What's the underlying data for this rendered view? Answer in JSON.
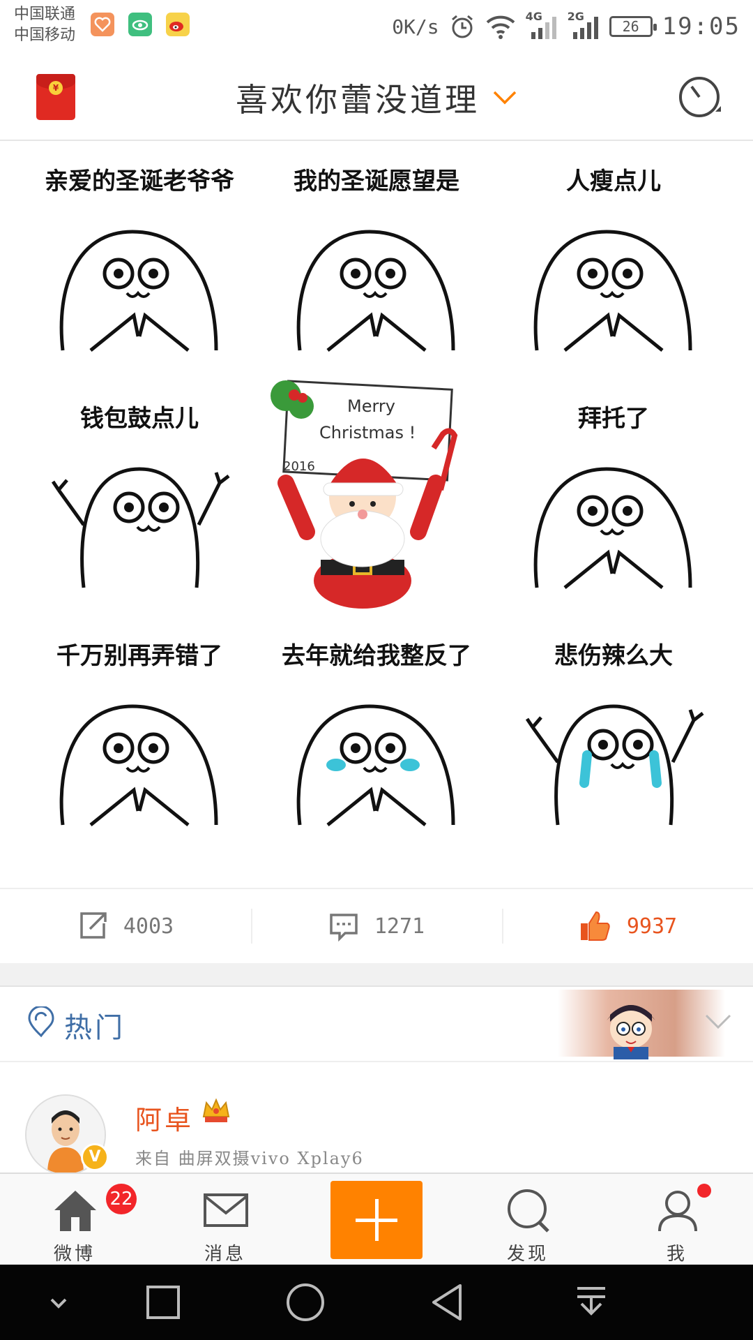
{
  "status_bar": {
    "carrier_1": "中国联通",
    "carrier_2": "中国移动",
    "net_speed": "0K/s",
    "net_1": "4G",
    "net_2": "2G",
    "battery": "26",
    "time": "19:05",
    "notification_icons": [
      "health-app-icon",
      "eye-app-icon",
      "weibo-app-icon"
    ]
  },
  "header": {
    "title": "喜欢你蕾没道理",
    "left_icon": "red-packet-icon",
    "right_icon": "timer-icon",
    "accent": "#ff8200"
  },
  "image_grid": {
    "cells": [
      {
        "caption": "亲爱的圣诞老爷爷",
        "pose": "praying"
      },
      {
        "caption": "我的圣诞愿望是",
        "pose": "praying"
      },
      {
        "caption": "人瘦点儿",
        "pose": "praying"
      },
      {
        "caption": "钱包鼓点儿",
        "pose": "arms-up"
      },
      {
        "caption": "",
        "pose": "santa",
        "sign_line_1": "Merry",
        "sign_line_2": "Christmas !",
        "sign_year": "2016"
      },
      {
        "caption": "拜托了",
        "pose": "praying"
      },
      {
        "caption": "千万别再弄错了",
        "pose": "praying"
      },
      {
        "caption": "去年就给我整反了",
        "pose": "crying"
      },
      {
        "caption": "悲伤辣么大",
        "pose": "crying-arms-up"
      }
    ]
  },
  "actions": {
    "repost_count": "4003",
    "comment_count": "1271",
    "like_count": "9937",
    "like_color": "#e8541e"
  },
  "hot_section": {
    "label": "热门"
  },
  "post": {
    "username": "阿卓",
    "source": "来自 曲屏双摄vivo Xplay6",
    "verified_badge": "V",
    "username_color": "#e8541e"
  },
  "tab_bar": {
    "tabs": [
      {
        "label": "微博",
        "icon": "home-icon",
        "badge": "22"
      },
      {
        "label": "消息",
        "icon": "mail-icon"
      },
      {
        "label": "",
        "icon": "plus-icon"
      },
      {
        "label": "发现",
        "icon": "search-icon"
      },
      {
        "label": "我",
        "icon": "profile-icon"
      }
    ],
    "compose_color": "#ff8200",
    "badge_color": "#f2262a"
  },
  "nav_bar": {
    "icons": [
      "collapse-icon",
      "recents-icon",
      "home-circle-icon",
      "back-icon",
      "notification-pulldown-icon"
    ]
  }
}
